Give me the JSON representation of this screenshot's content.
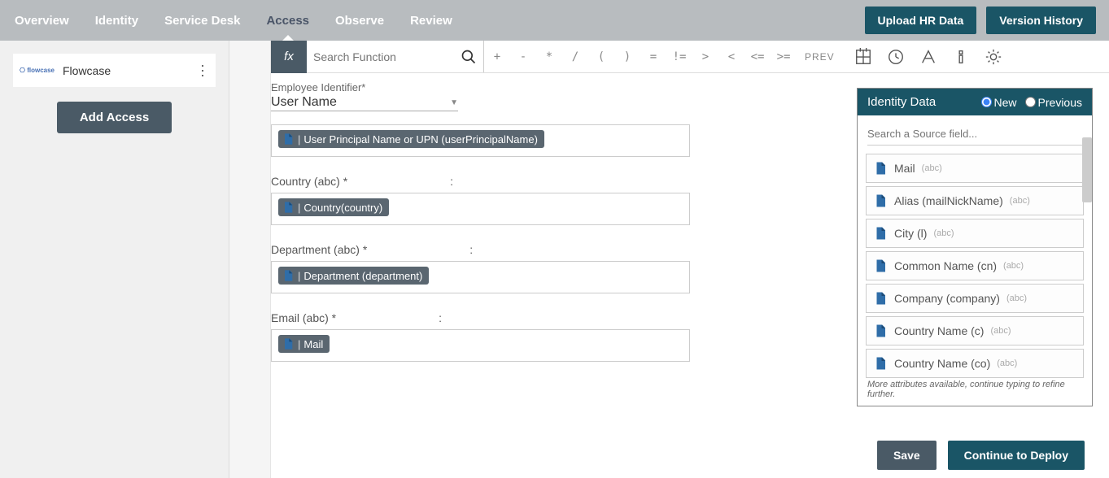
{
  "nav": {
    "tabs": [
      "Overview",
      "Identity",
      "Service Desk",
      "Access",
      "Observe",
      "Review"
    ],
    "active": "Access",
    "upload": "Upload HR Data",
    "version": "Version History"
  },
  "sidebar": {
    "app_logo": "⎔ flowcase",
    "app_name": "Flowcase",
    "add_access": "Add Access"
  },
  "formula": {
    "fx": "fx",
    "search_placeholder": "Search Function",
    "ops": [
      "+",
      "-",
      "*",
      "/",
      "(",
      ")",
      "=",
      "!=",
      ">",
      "<",
      "<=",
      ">="
    ],
    "prev": "PREV"
  },
  "emp": {
    "label": "Employee Identifier*",
    "value": "User Name",
    "chip": "User Principal Name or UPN (userPrincipalName)"
  },
  "fields": [
    {
      "label": "Country (abc) *",
      "chip": "Country(country)"
    },
    {
      "label": "Department (abc) *",
      "chip": "Department (department)"
    },
    {
      "label": "Email (abc) *",
      "chip": "Mail"
    }
  ],
  "right": {
    "title": "Identity Data",
    "new": "New",
    "prev": "Previous",
    "search_placeholder": "Search a Source field...",
    "items": [
      {
        "name": "Mail",
        "type": "(abc)"
      },
      {
        "name": "Alias (mailNickName)",
        "type": "(abc)"
      },
      {
        "name": "City (l)",
        "type": "(abc)"
      },
      {
        "name": "Common Name (cn)",
        "type": "(abc)"
      },
      {
        "name": "Company (company)",
        "type": "(abc)"
      },
      {
        "name": "Country Name (c)",
        "type": "(abc)"
      },
      {
        "name": "Country Name (co)",
        "type": "(abc)"
      }
    ],
    "more": "More attributes available, continue typing to refine further."
  },
  "footer": {
    "save": "Save",
    "deploy": "Continue to Deploy"
  }
}
